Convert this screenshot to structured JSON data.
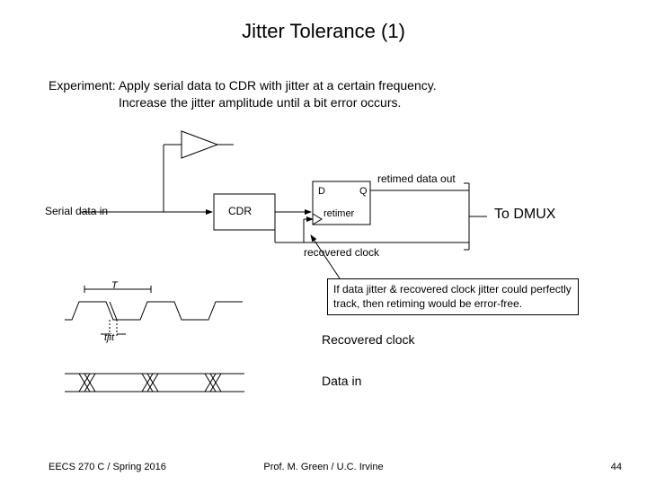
{
  "title": "Jitter Tolerance (1)",
  "experiment_l1": "Experiment:  Apply serial data to CDR with jitter at a certain frequency.",
  "experiment_l2": "Increase the jitter amplitude until a bit error occurs.",
  "labels": {
    "serial_in": "Serial data in",
    "cdr": "CDR",
    "retimer": "retimer",
    "retimed_out": "retimed data out",
    "recovered_clock": "recovered clock",
    "dq_d": "D",
    "dq_q": "Q",
    "to_dmux": "To DMUX",
    "T": "T",
    "tjit": "tjit",
    "section_recovered": "Recovered clock",
    "section_datain": "Data in"
  },
  "callout": "If data jitter & recovered clock jitter could perfectly track, then retiming would be error-free.",
  "footer": {
    "left": "EECS 270 C / Spring 2016",
    "center": "Prof. M. Green / U.C. Irvine",
    "right": "44"
  }
}
